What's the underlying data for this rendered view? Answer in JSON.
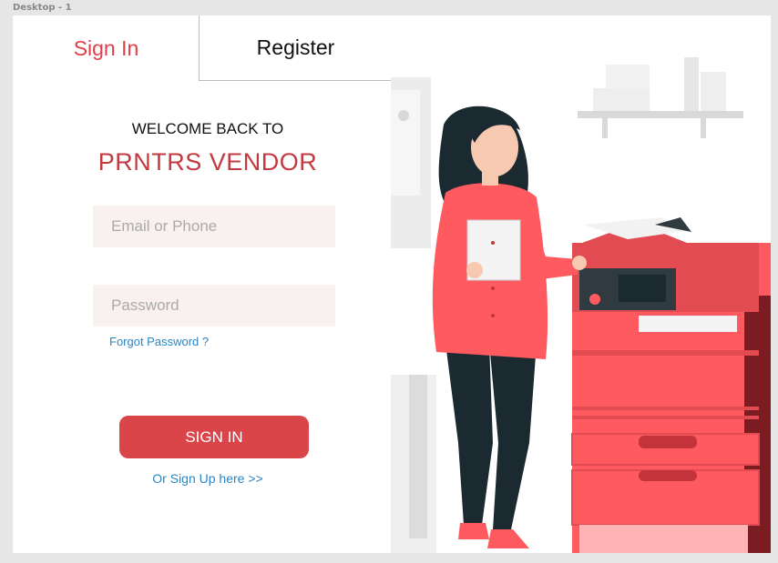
{
  "frame": {
    "label": "Desktop - 1"
  },
  "tabs": {
    "signin": "Sign In",
    "register": "Register"
  },
  "welcome": {
    "line1": "WELCOME BACK TO",
    "brand": "PRNTRS VENDOR"
  },
  "form": {
    "email_placeholder": "Email or Phone",
    "password_placeholder": "Password",
    "forgot": "Forgot Password ?",
    "submit": "SIGN IN",
    "signup": "Or Sign Up here >>"
  },
  "colors": {
    "accent": "#e0404a",
    "brand": "#c23a3f",
    "button": "#d94548",
    "link": "#2a86c4",
    "field_bg": "#f8f1f0"
  },
  "illustration": {
    "subject": "woman-using-printer-illustration"
  }
}
